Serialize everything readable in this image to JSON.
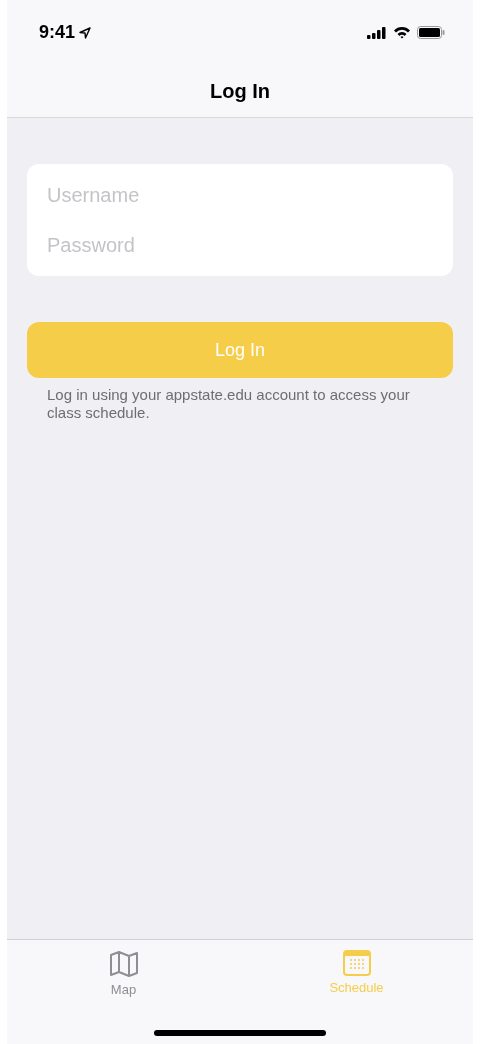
{
  "status_bar": {
    "time": "9:41"
  },
  "nav_bar": {
    "title": "Log In"
  },
  "form": {
    "fields": [
      {
        "placeholder": "Username"
      },
      {
        "placeholder": "Password"
      }
    ],
    "button": {
      "label": "Log In"
    },
    "help": "Log in using your appstate.edu account to access your class schedule."
  },
  "tab_bar": [
    {
      "label": "Map",
      "kind": "map",
      "selected": false
    },
    {
      "label": "Schedule",
      "kind": "calendar",
      "selected": true
    }
  ]
}
